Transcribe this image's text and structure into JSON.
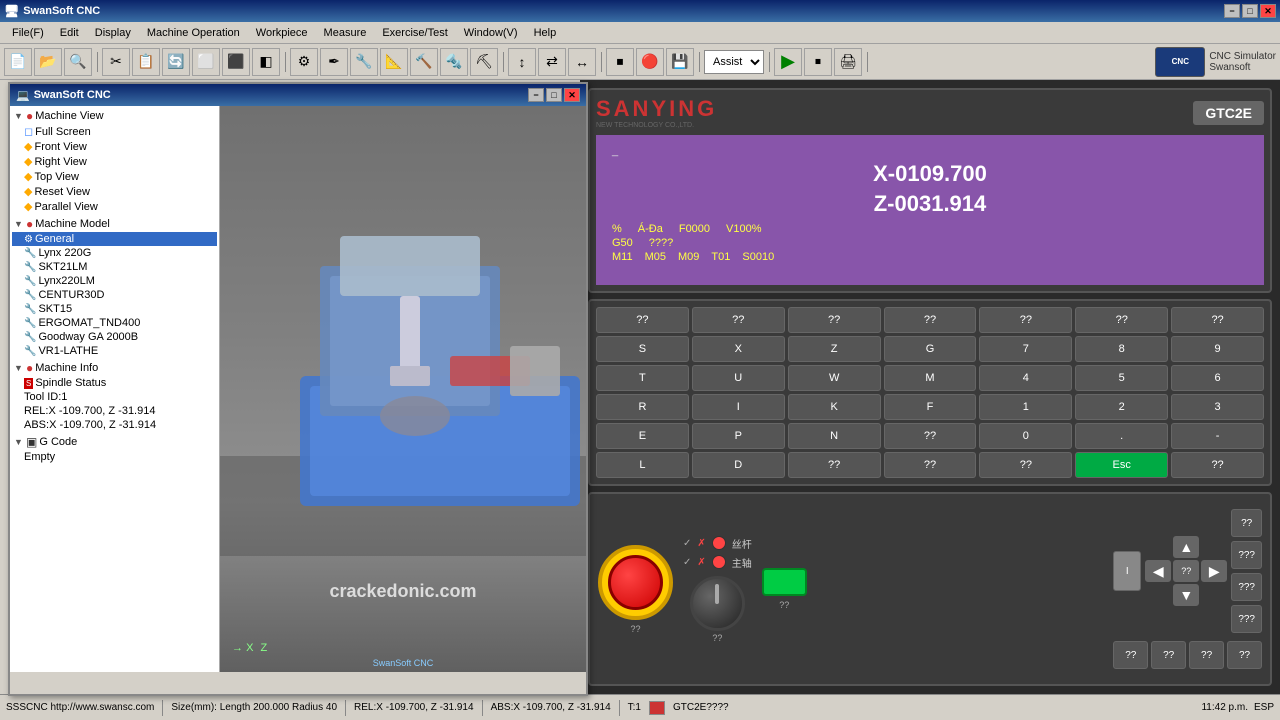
{
  "titlebar": {
    "title": "SwanSoft CNC",
    "minimize": "−",
    "maximize": "□",
    "close": "✕"
  },
  "menubar": {
    "items": [
      "File(F)",
      "Edit",
      "Display",
      "Machine Operation",
      "Workpiece",
      "Measure",
      "Exercise/Test",
      "Window(V)",
      "Help"
    ]
  },
  "toolbar": {
    "assist_label": "Assist",
    "assist_options": [
      "Assist"
    ]
  },
  "cnc_window": {
    "title": "SwanSoft CNC",
    "minimize": "−",
    "maximize": "□",
    "close": "✕"
  },
  "tree": {
    "items": [
      {
        "label": "Machine View",
        "level": 1,
        "type": "folder",
        "expanded": true
      },
      {
        "label": "Full Screen",
        "level": 2,
        "type": "item"
      },
      {
        "label": "Front View",
        "level": 2,
        "type": "item"
      },
      {
        "label": "Right View",
        "level": 2,
        "type": "item"
      },
      {
        "label": "Top View",
        "level": 2,
        "type": "item"
      },
      {
        "label": "Reset View",
        "level": 2,
        "type": "item"
      },
      {
        "label": "Parallel View",
        "level": 2,
        "type": "item"
      },
      {
        "label": "Machine Model",
        "level": 1,
        "type": "folder",
        "expanded": true
      },
      {
        "label": "General",
        "level": 2,
        "type": "item",
        "selected": true
      },
      {
        "label": "Lynx 220G",
        "level": 2,
        "type": "item"
      },
      {
        "label": "SKT21LM",
        "level": 2,
        "type": "item"
      },
      {
        "label": "Lynx220LM",
        "level": 2,
        "type": "item"
      },
      {
        "label": "CENTUR30D",
        "level": 2,
        "type": "item"
      },
      {
        "label": "SKT15",
        "level": 2,
        "type": "item"
      },
      {
        "label": "ERGOMAT_TND400",
        "level": 2,
        "type": "item"
      },
      {
        "label": "Goodway GA 2000B",
        "level": 2,
        "type": "item"
      },
      {
        "label": "VR1-LATHE",
        "level": 2,
        "type": "item"
      },
      {
        "label": "Machine Info",
        "level": 1,
        "type": "folder",
        "expanded": true
      },
      {
        "label": "Spindle Status",
        "level": 2,
        "type": "item"
      },
      {
        "label": "Tool ID:1",
        "level": 2,
        "type": "text"
      },
      {
        "label": "REL:X -109.700, Z -31.914",
        "level": 2,
        "type": "text"
      },
      {
        "label": "ABS:X -109.700, Z -31.914",
        "level": 2,
        "type": "text"
      },
      {
        "label": "G Code",
        "level": 1,
        "type": "folder",
        "expanded": true
      },
      {
        "label": "Empty",
        "level": 2,
        "type": "text"
      }
    ]
  },
  "viewport": {
    "watermark": "crackedonic.com",
    "axis_x": "X",
    "axis_z": "Z"
  },
  "controller": {
    "brand": "SANYING",
    "subtitle": "NEW TECHNOLOGY CO.,LTD.",
    "model": "GTC2E",
    "screen": {
      "coord_x": "X-0109.700",
      "coord_z": "Z-0031.914",
      "percent": "%",
      "mode": "Á-Ða",
      "feed": "F0000",
      "velocity": "V100%",
      "g50": "G50",
      "question1": "????",
      "m11": "M11",
      "m05": "M05",
      "m09": "M09",
      "t01": "T01",
      "s0010": "S0010"
    },
    "keypad_top": [
      "??",
      "??",
      "??",
      "??",
      "??",
      "??",
      "??"
    ],
    "keypad_rows": [
      [
        "S",
        "X",
        "Z",
        "G",
        "7",
        "8",
        "9"
      ],
      [
        "T",
        "U",
        "W",
        "M",
        "4",
        "5",
        "6"
      ],
      [
        "R",
        "I",
        "K",
        "F",
        "1",
        "2",
        "3"
      ],
      [
        "E",
        "P",
        "N",
        "??",
        "0",
        ".",
        "-"
      ],
      [
        "L",
        "D",
        "??",
        "??",
        "??",
        "Esc",
        "??"
      ]
    ],
    "controls": {
      "knob_label1": "??",
      "knob_label2": "??",
      "green_label": "??",
      "light_rows": [
        {
          "lights": [
            "✓",
            "✗",
            "label1"
          ],
          "label": "丝杆"
        },
        {
          "lights": [
            "✓",
            "✗",
            "label2"
          ],
          "label": "主轴"
        }
      ]
    },
    "right_buttons_top": [
      "I",
      "??",
      "???",
      "???",
      "???"
    ],
    "arrow_buttons": {
      "up": "▲",
      "down": "▼",
      "left": "◀",
      "right": "▶",
      "center": "??"
    },
    "right_buttons_grid": [
      "??",
      "???",
      "???",
      "???",
      "??",
      "??",
      "??",
      "??"
    ]
  },
  "statusbar": {
    "left": "SSSCNC http://www.swansc.com",
    "size": "Size(mm): Length 200.000 Radius 40",
    "rel": "REL:X -109.700, Z -31.914",
    "abs": "ABS:X -109.700, Z -31.914",
    "tool": "T:1",
    "model": "GTC2E????",
    "time": "11:42 p.m.",
    "lang": "ESP"
  }
}
